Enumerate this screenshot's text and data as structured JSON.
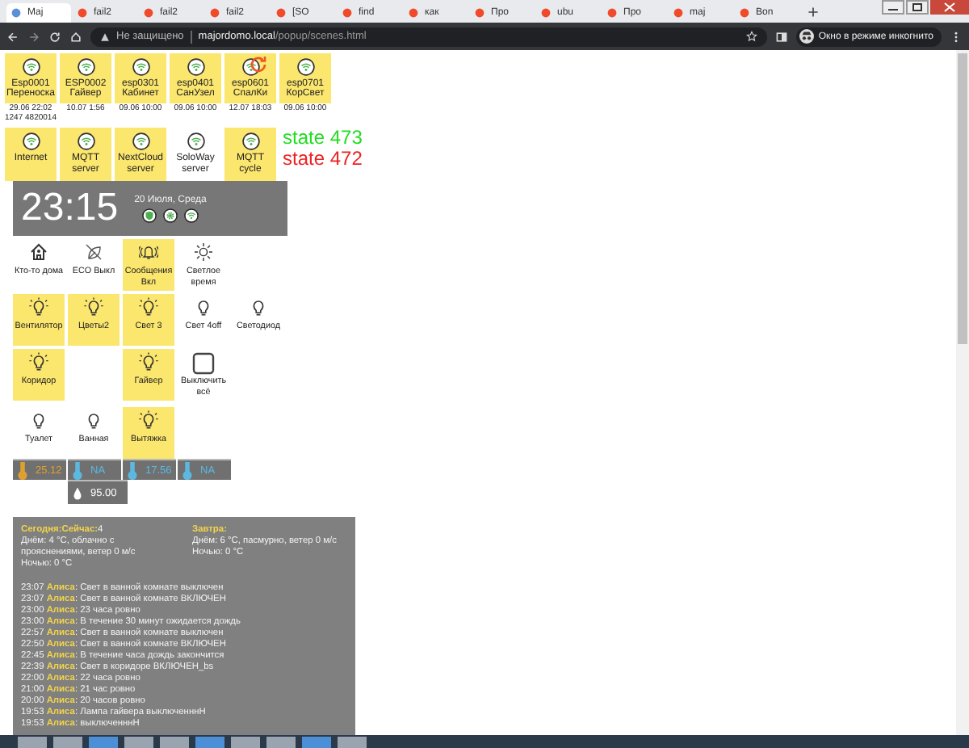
{
  "browser": {
    "tabs": [
      {
        "title": "Maj",
        "selected": true
      },
      {
        "title": "fail2",
        "selected": false
      },
      {
        "title": "fail2",
        "selected": false
      },
      {
        "title": "fail2",
        "selected": false
      },
      {
        "title": "[SO",
        "selected": false
      },
      {
        "title": "find",
        "selected": false
      },
      {
        "title": "как",
        "selected": false
      },
      {
        "title": "Про",
        "selected": false
      },
      {
        "title": "ubu",
        "selected": false
      },
      {
        "title": "Про",
        "selected": false
      },
      {
        "title": "maj",
        "selected": false
      },
      {
        "title": "Bon",
        "selected": false
      }
    ],
    "security": "Не защищено",
    "host": "majordomo.local",
    "path": "/popup/scenes.html",
    "incognito": "Окно в режиме инкогнито"
  },
  "devices": [
    {
      "name": "Esp0001",
      "place": "Переноска",
      "time": "29.06 22:02",
      "extra": "1247 4820014",
      "alert": false
    },
    {
      "name": "ESP0002",
      "place": "Гайвер",
      "time": "10.07 1:56",
      "alert": false
    },
    {
      "name": "esp0301",
      "place": "Кабинет",
      "time": "09.06 10:00",
      "alert": false
    },
    {
      "name": "esp0401",
      "place": "СанУзел",
      "time": "09.06 10:00",
      "alert": false
    },
    {
      "name": "esp0601",
      "place": "СпалКи",
      "time": "12.07 18:03",
      "alert": true
    },
    {
      "name": "esp0701",
      "place": "КорСвет",
      "time": "09.06 10:00",
      "alert": false
    }
  ],
  "services": [
    {
      "label": "Internet",
      "active": true
    },
    {
      "label": "MQTT server",
      "active": true
    },
    {
      "label": "NextCloud server",
      "active": true
    },
    {
      "label": "SoloWay server",
      "active": false
    },
    {
      "label": "MQTT cycle",
      "active": true
    }
  ],
  "states": [
    {
      "text": "state 473",
      "color": "#22dd22"
    },
    {
      "text": "state 472",
      "color": "#ee2222"
    }
  ],
  "clock": {
    "time": "23:15",
    "date": "20 Июля, Среда"
  },
  "scenes": [
    [
      {
        "kind": "house",
        "label": "Кто-то дома",
        "active": false
      },
      {
        "kind": "leaf-off",
        "label": "ECO Выкл",
        "active": false
      },
      {
        "kind": "bell",
        "label": "Сообщения Вкл",
        "active": true
      },
      {
        "kind": "sun",
        "label": "Светлое время",
        "active": false
      }
    ],
    [
      {
        "kind": "bulb",
        "label": "Вентилятор",
        "active": true
      },
      {
        "kind": "bulb",
        "label": "Цветы2",
        "active": true
      },
      {
        "kind": "bulb",
        "label": "Свет 3",
        "active": true
      },
      {
        "kind": "bulb",
        "label": "Свет 4off",
        "active": false
      },
      {
        "kind": "bulb",
        "label": "Светодиод",
        "active": false
      }
    ],
    [
      {
        "kind": "bulb",
        "label": "Коридор",
        "active": true
      },
      {
        "kind": "blank"
      },
      {
        "kind": "bulb",
        "label": "Гайвер",
        "active": true
      },
      {
        "kind": "square",
        "label": "Выключить всё",
        "active": false
      }
    ],
    [
      {
        "kind": "bulb",
        "label": "Туалет",
        "active": false
      },
      {
        "kind": "bulb",
        "label": "Ванная",
        "active": false
      },
      {
        "kind": "bulb",
        "label": "Вытяжка",
        "active": true
      }
    ]
  ],
  "sensors": [
    {
      "kind": "temperature",
      "value": "25.12",
      "color": "#e0a030"
    },
    {
      "kind": "temperature",
      "value": "NA",
      "color": "#5bb8e0"
    },
    {
      "kind": "temperature",
      "value": "17.56",
      "color": "#5bb8e0"
    },
    {
      "kind": "temperature",
      "value": "NA",
      "color": "#5bb8e0"
    },
    {
      "kind": "humidity",
      "value": "95.00",
      "color": "#ffffff"
    }
  ],
  "weather": [
    {
      "heading": "**Сегодня:Сейчас:**4",
      "day": "Днём: 4 °C, облачно с прояснениями, ветер 0 м/с",
      "night": "Ночью: 0 °C"
    },
    {
      "heading": "**Завтра:**",
      "day": "Днём: 6 °C, пасмурно, ветер 0 м/с",
      "night": "Ночью: 0 °C"
    }
  ],
  "log": [
    "23:07 **Алиса**: Свет в ванной комнате выключен",
    "23:07 **Алиса**: Свет в ванной комнате ВКЛЮЧЕН",
    "23:00 **Алиса**: 23 часа ровно",
    "23:00 **Алиса**: В течение 30 минут ожидается дождь",
    "22:57 **Алиса**: Свет в ванной комнате выключен",
    "22:50 **Алиса**: Свет в ванной комнате ВКЛЮЧЕН",
    "22:45 **Алиса**: В течение часа дождь закончится",
    "22:39 **Алиса**: Свет в коридоре ВКЛЮЧЕН_bs",
    "22:00 **Алиса**: 22 часа ровно",
    "21:00 **Алиса**: 21 час ровно",
    "20:00 **Алиса**: 20 часов ровно",
    "19:53 **Алиса**: Лампа гайвера выключенннН",
    "19:53 **Алиса**: выключенннН"
  ]
}
